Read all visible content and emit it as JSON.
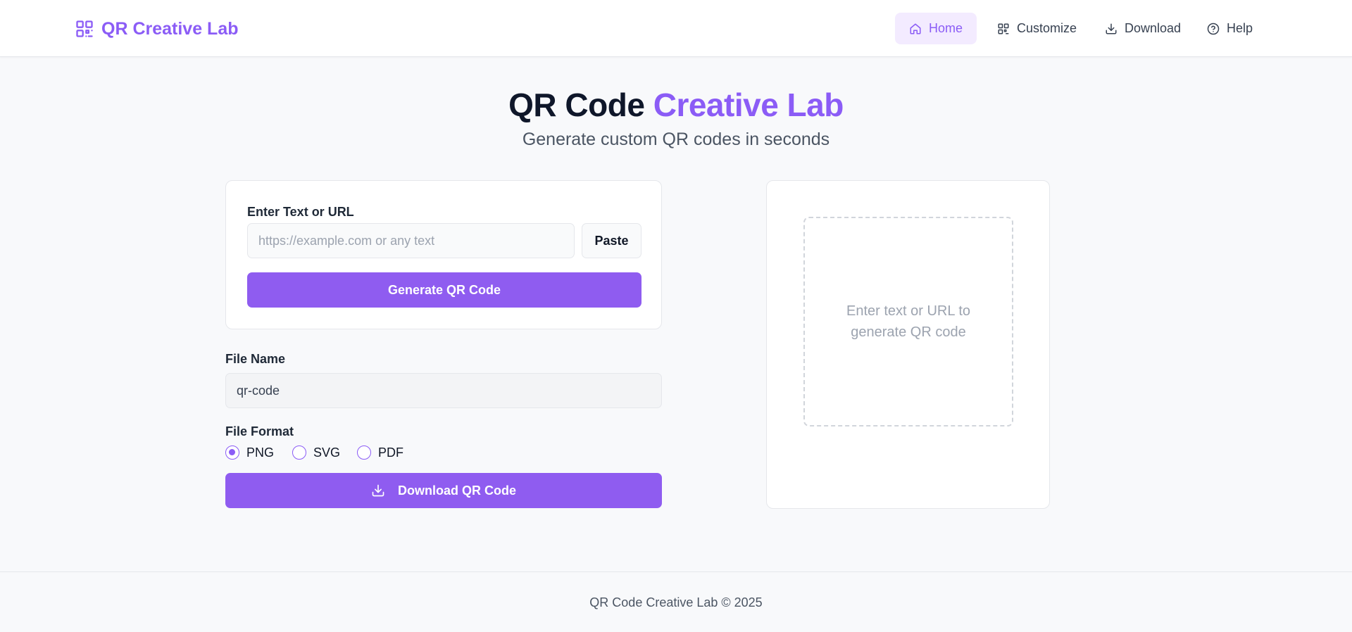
{
  "brand": {
    "name": "QR Creative Lab"
  },
  "nav": {
    "items": [
      {
        "label": "Home",
        "icon": "home-icon",
        "active": true
      },
      {
        "label": "Customize",
        "icon": "qr-grid-icon",
        "active": false
      },
      {
        "label": "Download",
        "icon": "download-icon",
        "active": false
      },
      {
        "label": "Help",
        "icon": "help-circle-icon",
        "active": false
      }
    ]
  },
  "hero": {
    "title_part1": "QR Code",
    "title_part2": "Creative Lab",
    "subtitle": "Generate custom QR codes in seconds"
  },
  "input_card": {
    "label": "Enter Text or URL",
    "placeholder": "https://example.com or any text",
    "value": "",
    "paste_label": "Paste",
    "generate_label": "Generate QR Code"
  },
  "file": {
    "name_label": "File Name",
    "name_value": "qr-code",
    "format_label": "File Format",
    "formats": [
      {
        "label": "PNG",
        "checked": true
      },
      {
        "label": "SVG",
        "checked": false
      },
      {
        "label": "PDF",
        "checked": false
      }
    ],
    "download_label": "Download QR Code"
  },
  "preview": {
    "placeholder": "Enter text or URL to generate QR code"
  },
  "footer": {
    "text": "QR Code Creative Lab © 2025"
  },
  "colors": {
    "accent": "#8b5cf6",
    "button": "#8f5cf0",
    "nav_active_bg": "#f3ebff"
  }
}
